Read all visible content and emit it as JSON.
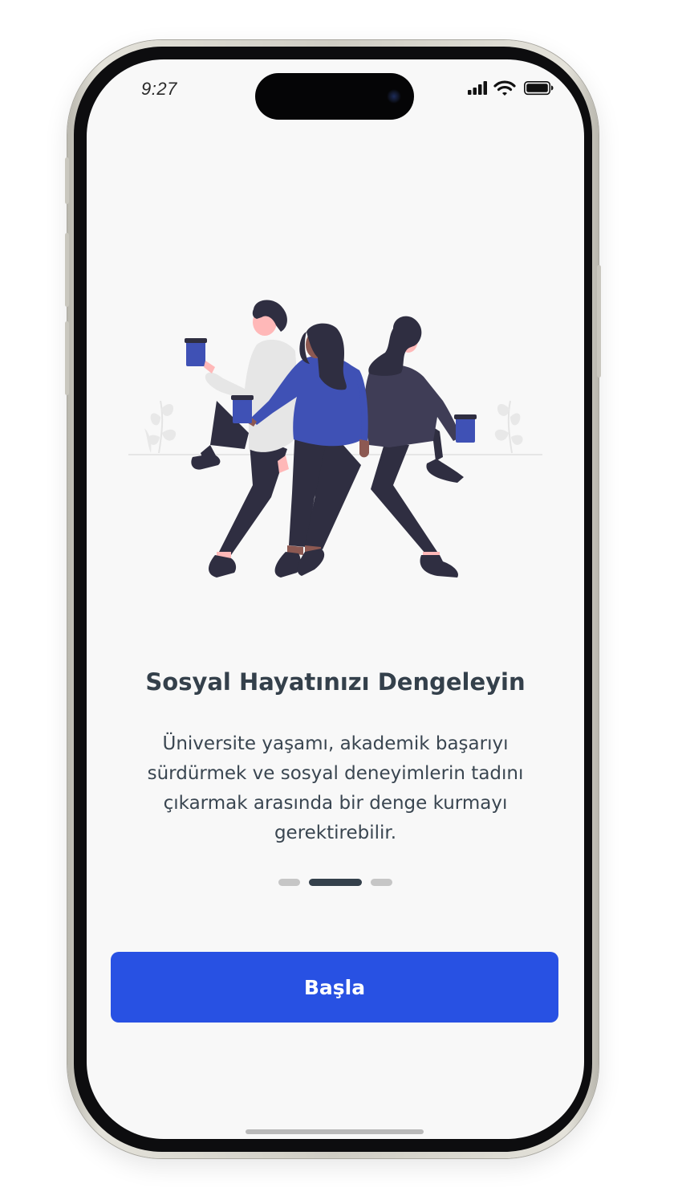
{
  "status_bar": {
    "time": "9:27",
    "icons": [
      "signal-icon",
      "wifi-icon",
      "battery-icon"
    ]
  },
  "onboarding": {
    "illustration": "people-socializing-illustration",
    "title": "Sosyal Hayatınızı Dengeleyin",
    "description": "Üniversite yaşamı, akademik başarıyı sürdürmek ve sosyal deneyimlerin tadını çıkarmak arasında bir denge kurmayı gerektirebilir.",
    "page_indicator": {
      "total": 3,
      "active": 2
    }
  },
  "actions": {
    "start_label": "Başla"
  },
  "colors": {
    "accent": "#2851e3",
    "title": "#34404b",
    "illustration_blue": "#3f51b5",
    "illustration_dark": "#2f2e41",
    "screen_background": "#f8f8f8"
  }
}
